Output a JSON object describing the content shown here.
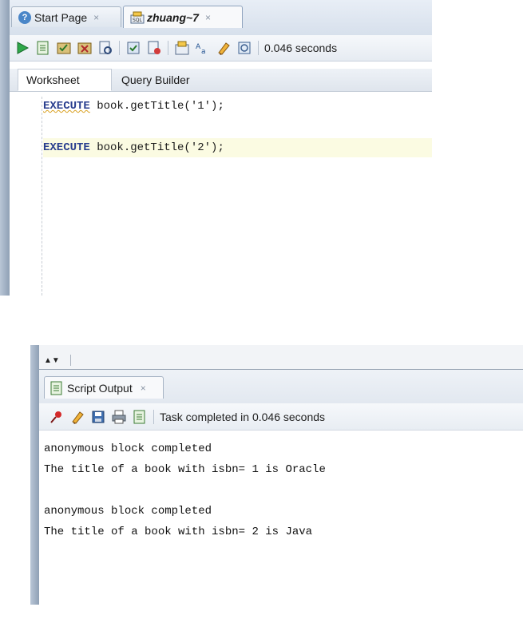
{
  "editor_window": {
    "tabs": [
      {
        "label": "Start Page",
        "icon": "help-icon",
        "close": "×"
      },
      {
        "label": "zhuang~7",
        "icon": "sql-worksheet-icon",
        "close": "×"
      }
    ],
    "toolbar": {
      "icons": [
        "run-statement-icon",
        "run-script-icon",
        "commit-icon",
        "rollback-icon",
        "autotrace-icon",
        "explain-plan-icon",
        "sql-tuning-icon",
        "sql-history-icon",
        "format-icon",
        "clear-icon",
        "unshared-worksheet-icon"
      ],
      "elapsed": "0.046 seconds"
    },
    "subtabs": [
      "Worksheet",
      "Query Builder"
    ],
    "code": [
      {
        "keyword": "EXECUTE",
        "rest": " book.getTitle('1');"
      },
      {
        "keyword": "EXECUTE",
        "rest": " book.getTitle('2');"
      }
    ]
  },
  "output_panel": {
    "tab": {
      "label": "Script Output",
      "close": "×"
    },
    "toolbar": {
      "icons": [
        "pin-icon",
        "clear-icon",
        "save-icon",
        "print-icon",
        "script-icon"
      ],
      "status": "Task completed in 0.046 seconds"
    },
    "lines": [
      "anonymous block completed",
      "The title of a book with isbn= 1 is Oracle",
      "",
      "anonymous block completed",
      "The title of a book with isbn= 2 is Java"
    ]
  },
  "colors": {
    "keyword": "#2a3f8f",
    "current_line_highlight": "#fbfbe2",
    "chrome": "#dfe6ef"
  }
}
